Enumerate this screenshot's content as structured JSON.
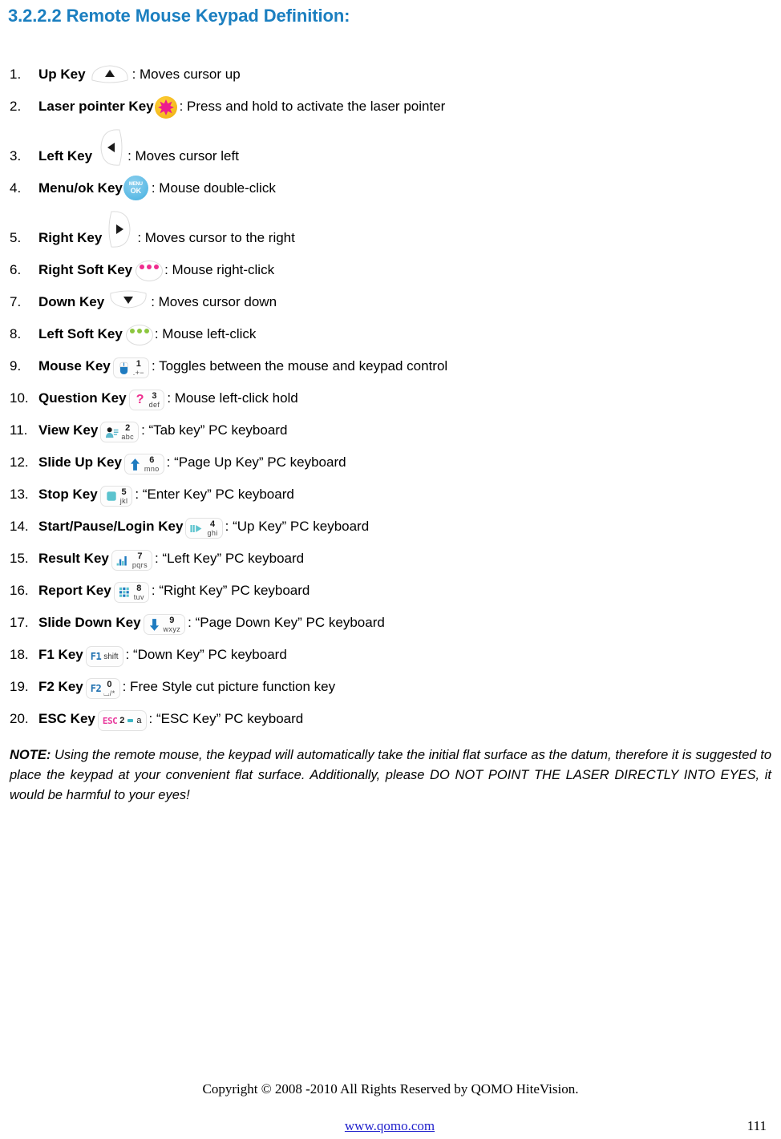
{
  "heading": "3.2.2.2 Remote Mouse Keypad Definition:",
  "heading_color": "#1B7FC0",
  "items": [
    {
      "num": "1.",
      "label": "Up Key",
      "icon": "fan-up-icon",
      "desc": ": Moves cursor up"
    },
    {
      "num": "2.",
      "label": "Laser pointer Key",
      "icon": "laser-pointer-icon",
      "desc": ": Press and hold to activate the laser pointer"
    },
    {
      "num": "3.",
      "label": "Left Key",
      "icon": "fan-left-icon",
      "desc": ": Moves cursor left"
    },
    {
      "num": "4.",
      "label": "Menu/ok Key",
      "icon": "menu-ok-icon",
      "desc": ": Mouse double-click",
      "icon_text_top": "MENU",
      "icon_text_bottom": "OK"
    },
    {
      "num": "5.",
      "label": "Right Key",
      "icon": "fan-right-icon",
      "desc": ": Moves cursor to the right"
    },
    {
      "num": "6.",
      "label": "Right Soft Key",
      "icon": "soft-key-magenta-icon",
      "desc": ":  Mouse right-click",
      "dot_color": "#EE2D8E"
    },
    {
      "num": "7.",
      "label": "Down Key",
      "icon": "fan-down-icon",
      "desc": ": Moves cursor down"
    },
    {
      "num": "8.",
      "label": "Left Soft Key",
      "icon": "soft-key-green-icon",
      "desc": ": Mouse left-click",
      "dot_color": "#8CC63F"
    },
    {
      "num": "9.",
      "label": "Mouse Key",
      "icon": "keypad-mouse-icon",
      "desc": ": Toggles between the mouse and keypad control",
      "num_char": "1",
      "sub_char": ".+−"
    },
    {
      "num": "10.",
      "label": "Question Key",
      "icon": "keypad-question-icon",
      "desc": ": Mouse left-click hold",
      "num_char": "3",
      "sub_char": "def"
    },
    {
      "num": "11.",
      "label": "View Key",
      "icon": "keypad-view-icon",
      "desc": ": “Tab key” PC keyboard",
      "num_char": "2",
      "sub_char": "abc"
    },
    {
      "num": "12.",
      "label": "Slide Up Key",
      "icon": "keypad-slide-up-icon",
      "desc": ": “Page Up Key” PC keyboard",
      "num_char": "6",
      "sub_char": "mno"
    },
    {
      "num": "13.",
      "label": "Stop Key",
      "icon": "keypad-stop-icon",
      "desc": ": “Enter Key” PC keyboard",
      "num_char": "5",
      "sub_char": "jkl"
    },
    {
      "num": "14.",
      "label": "Start/Pause/Login Key",
      "icon": "keypad-play-icon",
      "desc": ": “Up Key” PC keyboard",
      "num_char": "4",
      "sub_char": "ghi"
    },
    {
      "num": "15.",
      "label": "Result Key",
      "icon": "keypad-chart-icon",
      "desc": ": “Left Key” PC keyboard",
      "num_char": "7",
      "sub_char": "pqrs"
    },
    {
      "num": "16.",
      "label": "Report Key",
      "icon": "keypad-grid-icon",
      "desc": ": “Right Key” PC keyboard",
      "num_char": "8",
      "sub_char": "tuv"
    },
    {
      "num": "17.",
      "label": "Slide Down Key",
      "icon": "keypad-slide-down-icon",
      "desc": ": “Page Down Key” PC keyboard",
      "num_char": "9",
      "sub_char": "wxyz"
    },
    {
      "num": "18.",
      "label": "F1 Key",
      "icon": "keypad-f1-icon",
      "desc": ": “Down Key” PC keyboard",
      "num_char": "F1",
      "sub_char": "shift"
    },
    {
      "num": "19.",
      "label": "F2 Key",
      "icon": "keypad-f2-icon",
      "desc": ": Free Style cut picture function key",
      "num_char": "0",
      "sub_char": "⌴/*",
      "ftxt": "F2"
    },
    {
      "num": "20.",
      "label": "ESC Key",
      "icon": "keypad-esc-icon",
      "desc": ": “ESC Key” PC keyboard",
      "num_char": "2",
      "sub_char": "a",
      "ftxt": "ESC"
    }
  ],
  "note": {
    "prefix": "NOTE:",
    "body": " Using the remote mouse, the keypad will automatically take the initial flat surface as the datum, therefore it is suggested to place the keypad at your convenient flat surface. Additionally, please DO NOT POINT THE LASER DIRECTLY INTO EYES, it would be harmful to your eyes!"
  },
  "footer": {
    "copyright": "Copyright © 2008 -2010 All Rights Reserved by QOMO HiteVision.",
    "url": "www.qomo.com",
    "url_color": "#2222CC",
    "page_number": "111"
  }
}
